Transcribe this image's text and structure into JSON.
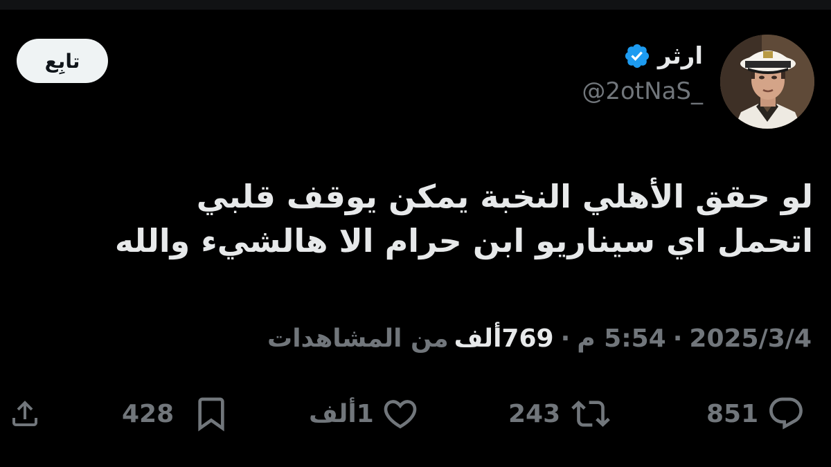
{
  "author": {
    "display_name": "ارثر",
    "handle": "@2otNaS_",
    "verified": true,
    "verified_color": "#1d9bf0"
  },
  "follow_button": {
    "label": "تابِع"
  },
  "tweet": {
    "lines": [
      "لو حقق الأهلي النخبة يمكن يوقف قلبي",
      "اتحمل اي سيناريو ابن حرام الا هالشيء والله"
    ]
  },
  "meta": {
    "date": "2025/3/4",
    "time": "5:54 م",
    "separator": "·",
    "views_count": "769",
    "views_unit": "ألف",
    "views_label": "من المشاهدات"
  },
  "actions": {
    "replies": "851",
    "retweets": "243",
    "likes": "1ألف",
    "bookmarks": "428"
  },
  "icons": {
    "reply": "reply-icon",
    "retweet": "retweet-icon",
    "like": "heart-icon",
    "bookmark": "bookmark-icon",
    "share": "share-icon"
  },
  "colors": {
    "background": "#000000",
    "text": "#e7e9ea",
    "muted": "#71767b",
    "follow_bg": "#eff3f4"
  }
}
